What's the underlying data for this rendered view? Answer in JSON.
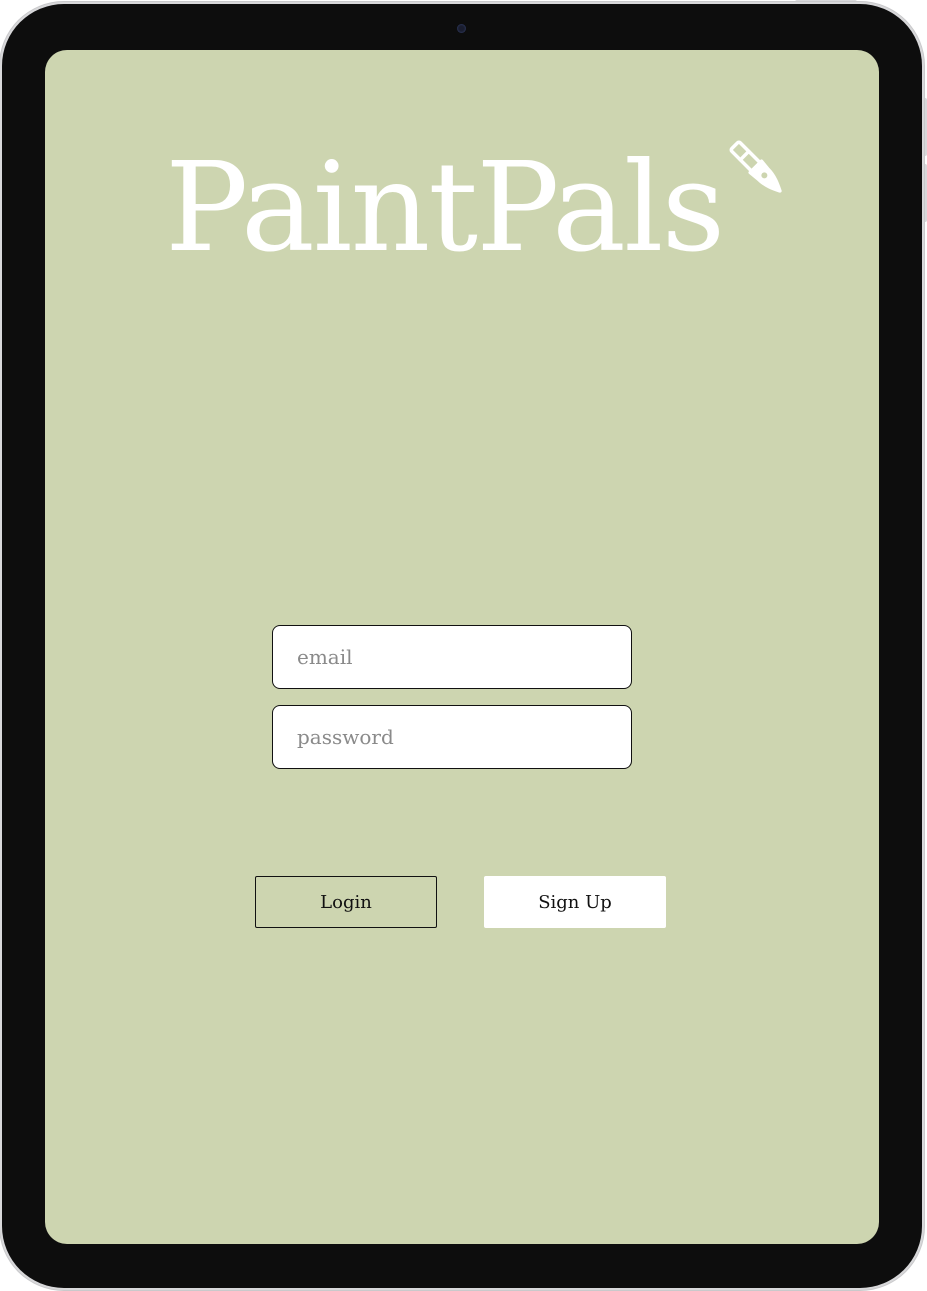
{
  "app": {
    "title": "PaintPals"
  },
  "login_form": {
    "email_placeholder": "email",
    "password_placeholder": "password",
    "login_label": "Login",
    "signup_label": "Sign Up"
  },
  "icons": {
    "logo_icon": "paintbrush-icon"
  },
  "colors": {
    "screen_background": "#cdd5b0",
    "logo_text": "#ffffff",
    "signup_button_background": "#ffffff",
    "device_bezel": "#0d0d0d"
  }
}
